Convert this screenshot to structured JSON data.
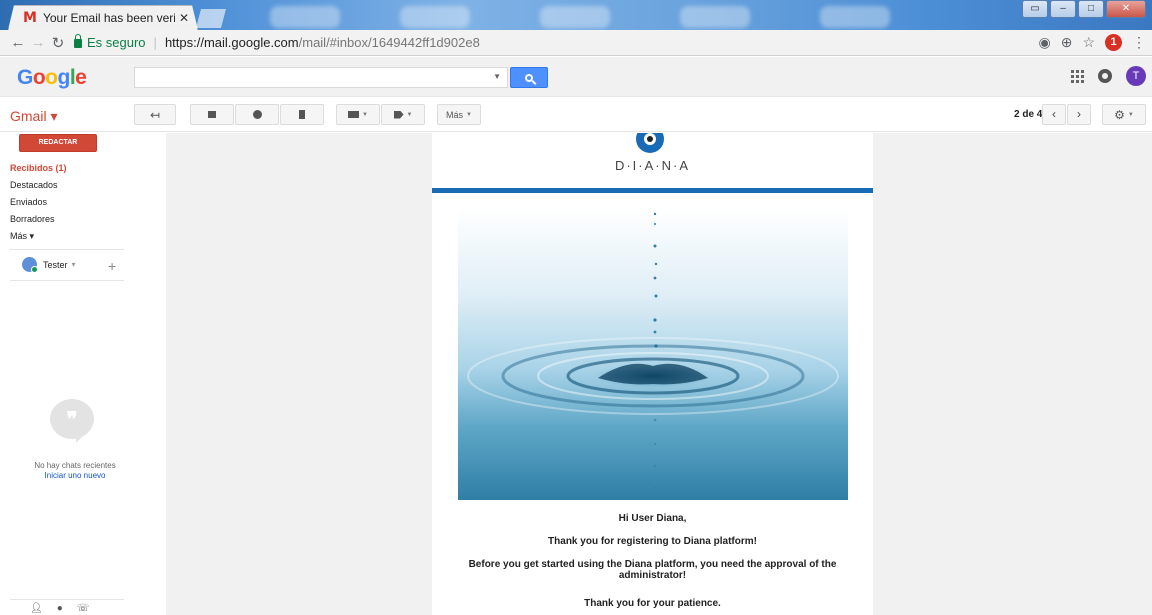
{
  "browser": {
    "tab_title": "Your Email has been verif",
    "tab_close": "✕",
    "address": {
      "secure_label": "Es seguro",
      "url_scheme_host": "https://mail.google.com",
      "url_path": "/mail/#inbox/1649442ff1d902e8"
    },
    "extension_badge": "1"
  },
  "header": {
    "logo_letters": [
      "G",
      "o",
      "o",
      "g",
      "l",
      "e"
    ],
    "search_value": "",
    "avatar_letter": "T"
  },
  "toolbar": {
    "gmail_label": "Gmail ▾",
    "more_label": "Más",
    "pager_text": "2 de 4"
  },
  "sidebar": {
    "compose_label": "REDACTAR",
    "items": [
      {
        "label": "Recibidos (1)",
        "active": true
      },
      {
        "label": "Destacados"
      },
      {
        "label": "Enviados"
      },
      {
        "label": "Borradores"
      },
      {
        "label": "Más ▾"
      }
    ],
    "user_name": "Tester",
    "no_chats_text": "No hay chats recientes",
    "start_chat_link": "Iniciar uno nuevo"
  },
  "email": {
    "brand_name": "D·I·A·N·A",
    "accent_color": "#1a6bb5",
    "greeting": "Hi User Diana,",
    "line1": "Thank you for registering to Diana platform!",
    "line2": "Before you get started using the Diana platform, you need the approval of the administrator!",
    "line3": "Thank you for your patience."
  }
}
